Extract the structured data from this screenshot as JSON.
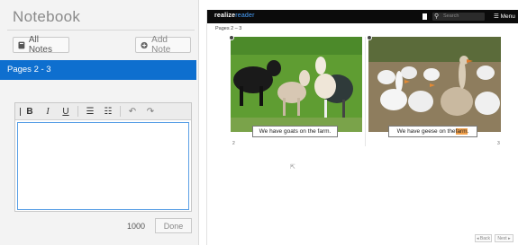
{
  "notebook": {
    "title": "Notebook",
    "all_notes_label": "All Notes",
    "add_note_label": "Add Note",
    "page_tab": "Pages 2 - 3",
    "toolbar": {
      "bold": "B",
      "italic": "I",
      "underline": "U",
      "bullets": "☰",
      "numbered": "☷",
      "undo": "↶",
      "redo": "↷"
    },
    "editor_value": "",
    "char_count": "1000",
    "done_label": "Done"
  },
  "reader": {
    "brand_main": "realize",
    "brand_accent": "reader",
    "search_placeholder": "Search",
    "menu_label": "☰ Menu",
    "pages_label": "Pages 2 – 3",
    "left_caption": "We have goats on the farm.",
    "right_caption_prefix": "We have geese on the ",
    "right_caption_highlight": "farm",
    "right_caption_suffix": ".",
    "left_page_number": "2",
    "right_page_number": "3",
    "back_label": "◂ Back",
    "next_label": "Next ▸"
  },
  "colors": {
    "accent": "#0e6fcf",
    "highlight": "#f4a24c",
    "topbar": "#0b0b0b"
  }
}
